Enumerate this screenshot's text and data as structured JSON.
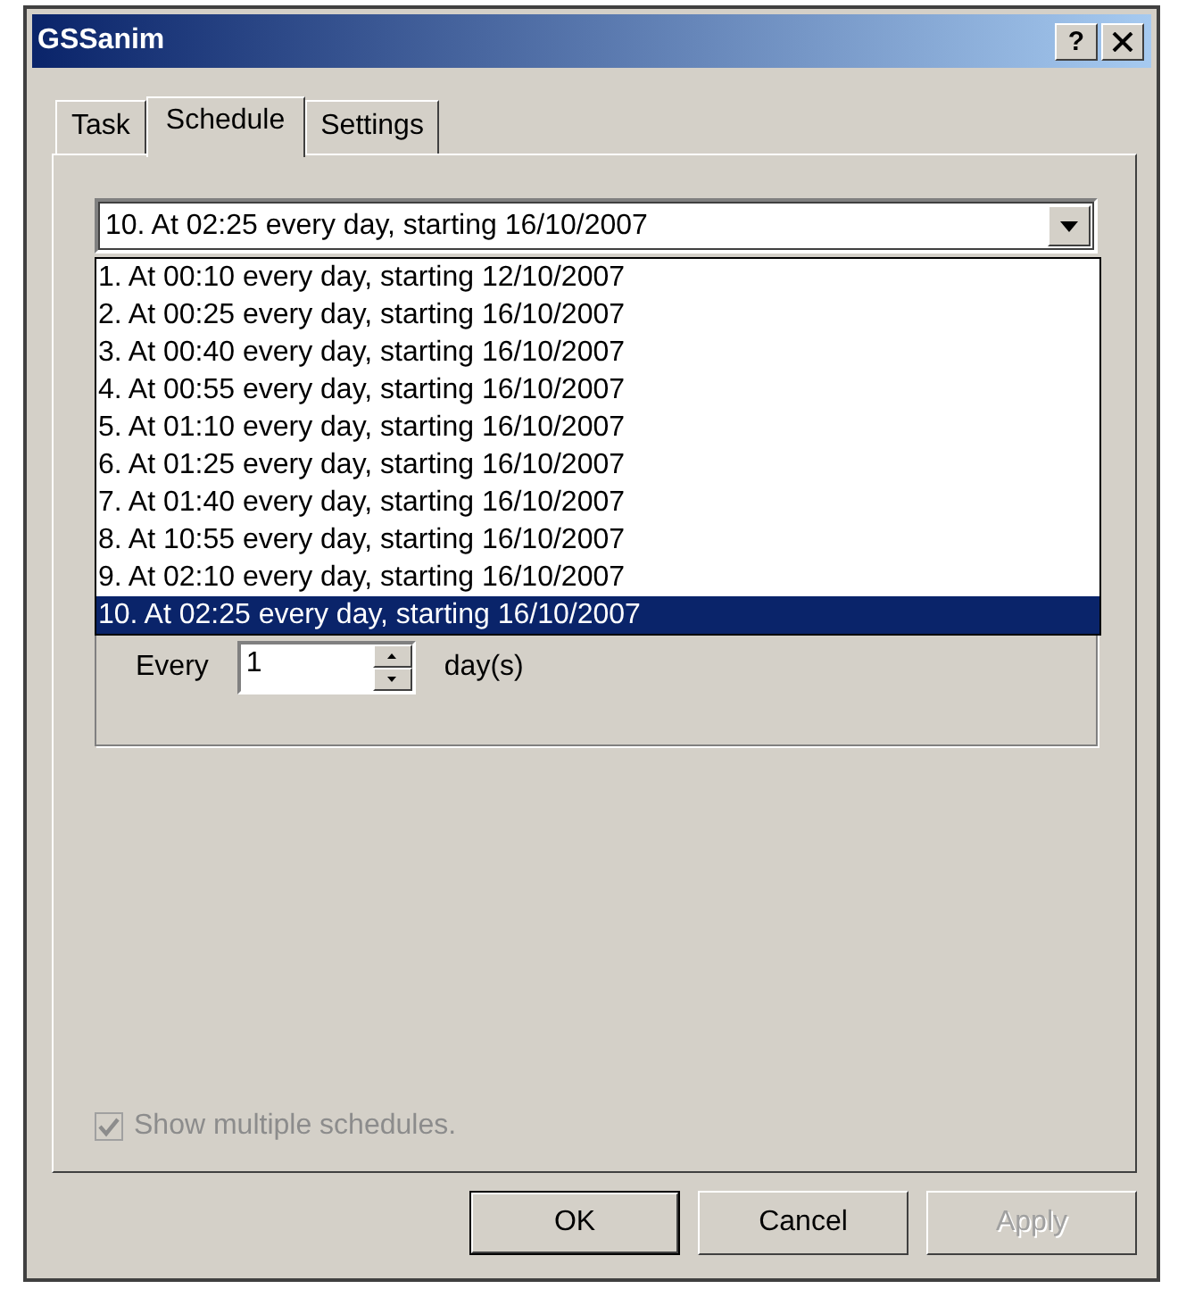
{
  "window": {
    "title": "GSSanim",
    "help_button": "?"
  },
  "tabs": [
    {
      "label": "Task",
      "selected": false
    },
    {
      "label": "Schedule",
      "selected": true
    },
    {
      "label": "Settings",
      "selected": false
    }
  ],
  "schedule_dropdown": {
    "value": "10. At 02:25 every day, starting 16/10/2007",
    "expanded": true,
    "options": [
      {
        "label": "1. At 00:10 every day, starting 12/10/2007",
        "selected": false
      },
      {
        "label": "2. At 00:25 every day, starting 16/10/2007",
        "selected": false
      },
      {
        "label": "3. At 00:40 every day, starting 16/10/2007",
        "selected": false
      },
      {
        "label": "4. At 00:55 every day, starting 16/10/2007",
        "selected": false
      },
      {
        "label": "5. At 01:10 every day, starting 16/10/2007",
        "selected": false
      },
      {
        "label": "6. At 01:25 every day, starting 16/10/2007",
        "selected": false
      },
      {
        "label": "7. At 01:40 every day, starting 16/10/2007",
        "selected": false
      },
      {
        "label": "8. At 10:55 every day, starting 16/10/2007",
        "selected": false
      },
      {
        "label": "9. At 02:10 every day, starting 16/10/2007",
        "selected": false
      },
      {
        "label": "10. At 02:25 every day, starting 16/10/2007",
        "selected": true
      }
    ]
  },
  "interval": {
    "label": "Every",
    "value": "1",
    "unit": "day(s)"
  },
  "show_multiple": {
    "label": "Show multiple schedules.",
    "checked": true,
    "disabled": true
  },
  "buttons": [
    {
      "label": "OK",
      "default": true,
      "disabled": false
    },
    {
      "label": "Cancel",
      "default": false,
      "disabled": false
    },
    {
      "label": "Apply",
      "default": false,
      "disabled": true
    }
  ]
}
